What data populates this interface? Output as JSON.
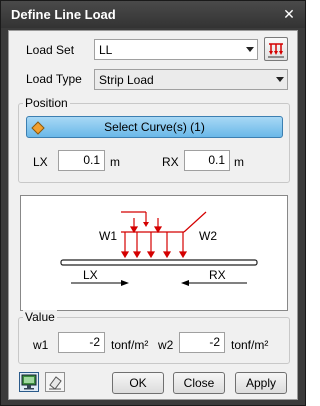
{
  "window": {
    "title": "Define Line Load"
  },
  "load_set": {
    "label": "Load Set",
    "value": "LL"
  },
  "load_type": {
    "label": "Load Type",
    "value": "Strip Load"
  },
  "position": {
    "group_label": "Position",
    "select_curves_label": "Select Curve(s) (1)",
    "lx_label": "LX",
    "lx_value": "0.1",
    "lx_unit": "m",
    "rx_label": "RX",
    "rx_value": "0.1",
    "rx_unit": "m"
  },
  "diagram": {
    "w1": "W1",
    "w2": "W2",
    "lx": "LX",
    "rx": "RX"
  },
  "value": {
    "group_label": "Value",
    "w1_label": "w1",
    "w1_value": "-2",
    "w1_unit": "tonf/m²",
    "w2_label": "w2",
    "w2_value": "-2",
    "w2_unit": "tonf/m²"
  },
  "buttons": {
    "ok": "OK",
    "close": "Close",
    "apply": "Apply"
  },
  "colors": {
    "accent_blue": "#6ab8e8",
    "load_red": "#d40000"
  }
}
